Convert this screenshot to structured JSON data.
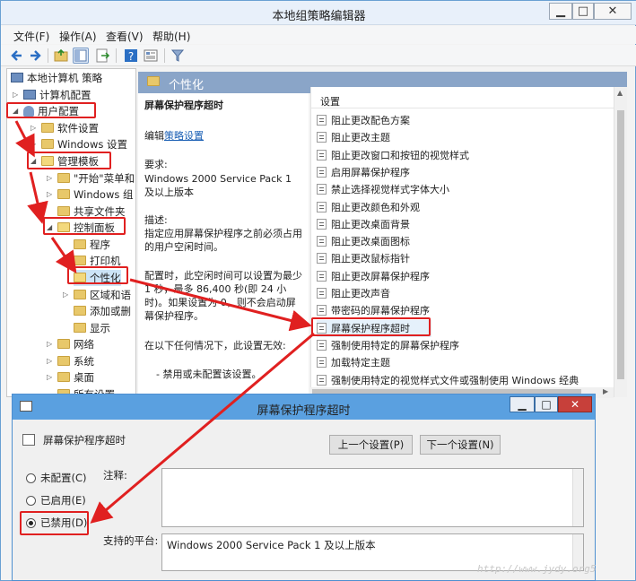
{
  "window": {
    "title": "本地组策略编辑器",
    "min": "▁",
    "max": "□",
    "close": "✕"
  },
  "menu": [
    "文件(F)",
    "操作(A)",
    "查看(V)",
    "帮助(H)"
  ],
  "tree": {
    "root": "本地计算机 策略",
    "computer_config": "计算机配置",
    "user_config": "用户配置",
    "software_settings": "软件设置",
    "windows_settings": "Windows 设置",
    "admin_templates": "管理模板",
    "start_menu": "\"开始\"菜单和",
    "windows_components": "Windows 组",
    "shared_folders": "共享文件夹",
    "control_panel": "控制面板",
    "programs": "程序",
    "printers": "打印机",
    "personalization": "个性化",
    "region_lang": "区域和语",
    "add_remove": "添加或删",
    "display": "显示",
    "network": "网络",
    "system": "系统",
    "desktop": "桌面",
    "all_settings": "所有设置"
  },
  "mid_header": "个性化",
  "description": {
    "title": "屏幕保护程序超时",
    "edit_prefix": "编辑",
    "edit_link": "策略设置",
    "req_label": "要求:",
    "req_value": "Windows 2000 Service Pack 1 及以上版本",
    "desc_label": "描述:",
    "desc_value": "指定应用屏幕保护程序之前必须占用的用户空闲时间。",
    "config_text": "配置时，此空闲时间可以设置为最少 1 秒，最多 86,400 秒(即 24 小时)。如果设置为 0，则不会启动屏幕保护程序。",
    "invalid_text": "在以下任何情况下，此设置无效:",
    "bullet": "- 禁用或未配置该设置。"
  },
  "list": {
    "header": "设置",
    "items": [
      "阻止更改配色方案",
      "阻止更改主题",
      "阻止更改窗口和按钮的视觉样式",
      "启用屏幕保护程序",
      "禁止选择视觉样式字体大小",
      "阻止更改颜色和外观",
      "阻止更改桌面背景",
      "阻止更改桌面图标",
      "阻止更改鼠标指针",
      "阻止更改屏幕保护程序",
      "阻止更改声音",
      "带密码的屏幕保护程序",
      "屏幕保护程序超时",
      "强制使用特定的屏幕保护程序",
      "加载特定主题",
      "强制使用特定的视觉样式文件或强制使用 Windows 经典"
    ],
    "selected_index": 12
  },
  "dialog": {
    "title": "屏幕保护程序超时",
    "setting_name": "屏幕保护程序超时",
    "prev_button": "上一个设置(P)",
    "next_button": "下一个设置(N)",
    "radio_not_configured": "未配置(C)",
    "radio_enabled": "已启用(E)",
    "radio_disabled": "已禁用(D)",
    "selected": "disabled",
    "comment_label": "注释:",
    "platform_label": "支持的平台:",
    "platform_value": "Windows 2000 Service Pack 1 及以上版本"
  },
  "watermark": "http://www.jydy.org5",
  "colors": {
    "annotation": "#e02020",
    "header_blue": "#8aa5c8",
    "dialog_title": "#5aa0e0"
  }
}
